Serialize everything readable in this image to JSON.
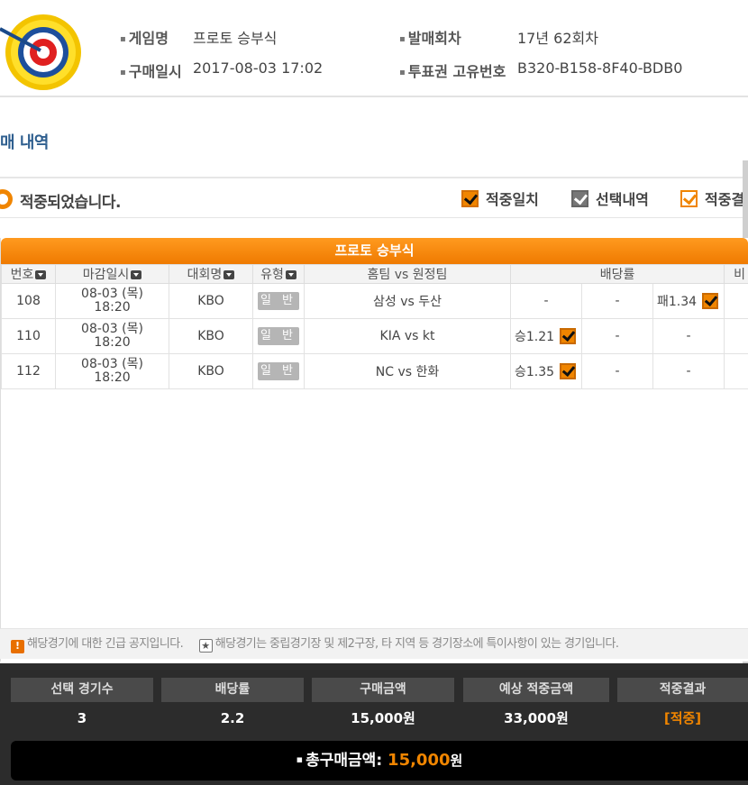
{
  "header": {
    "game_name_label": "게임명",
    "game_name": "프로토 승부식",
    "purchase_time_label": "구매일시",
    "purchase_time": "2017-08-03 17:02",
    "round_label": "발매회차",
    "round": "17년 62회차",
    "ticket_id_label": "투표권 고유번호",
    "ticket_id": "B320-B158-8F40-BDB0"
  },
  "section_title": "매 내역",
  "status": {
    "message": "적중되었습니다.",
    "legend": [
      {
        "label": "적중일치",
        "style": "orange"
      },
      {
        "label": "선택내역",
        "style": "gray"
      },
      {
        "label": "적중결",
        "style": "outline"
      }
    ]
  },
  "table": {
    "title": "프로토 승부식",
    "columns": {
      "no": "번호",
      "deadline": "마감일시",
      "league": "대회명",
      "type": "유형",
      "match": "홈팀 vs 원정팀",
      "odds": "배당률",
      "extra": "비"
    },
    "rows": [
      {
        "no": "108",
        "date": "08-03 (목)",
        "time": "18:20",
        "league": "KBO",
        "type": "일 반",
        "match": "삼성 vs 두산",
        "win": "-",
        "draw": "-",
        "lose": "패1.34",
        "pick": "lose"
      },
      {
        "no": "110",
        "date": "08-03 (목)",
        "time": "18:20",
        "league": "KBO",
        "type": "일 반",
        "match": "KIA vs kt",
        "win": "승1.21",
        "draw": "-",
        "lose": "-",
        "pick": "win"
      },
      {
        "no": "112",
        "date": "08-03 (목)",
        "time": "18:20",
        "league": "KBO",
        "type": "일 반",
        "match": "NC vs 한화",
        "win": "승1.35",
        "draw": "-",
        "lose": "-",
        "pick": "win"
      }
    ]
  },
  "notice": {
    "urgent": "해당경기에 대한 긴급 공지입니다.",
    "special": "해당경기는 중립경기장 및 제2구장, 타 지역 등 경기장소에 특이사항이 있는 경기입니다."
  },
  "summary": {
    "headers": [
      "선택 경기수",
      "배당률",
      "구매금액",
      "예상 적중금액",
      "적중결과"
    ],
    "values": [
      "3",
      "2.2",
      "15,000원",
      "33,000원",
      "[적중]"
    ],
    "total_label": "총구매금액:",
    "total_amount": "15,000",
    "total_unit": "원"
  },
  "colors": {
    "accent": "#f08500",
    "table_title_bg": "#ef7a00",
    "summary_bg": "#2c2c2c"
  }
}
